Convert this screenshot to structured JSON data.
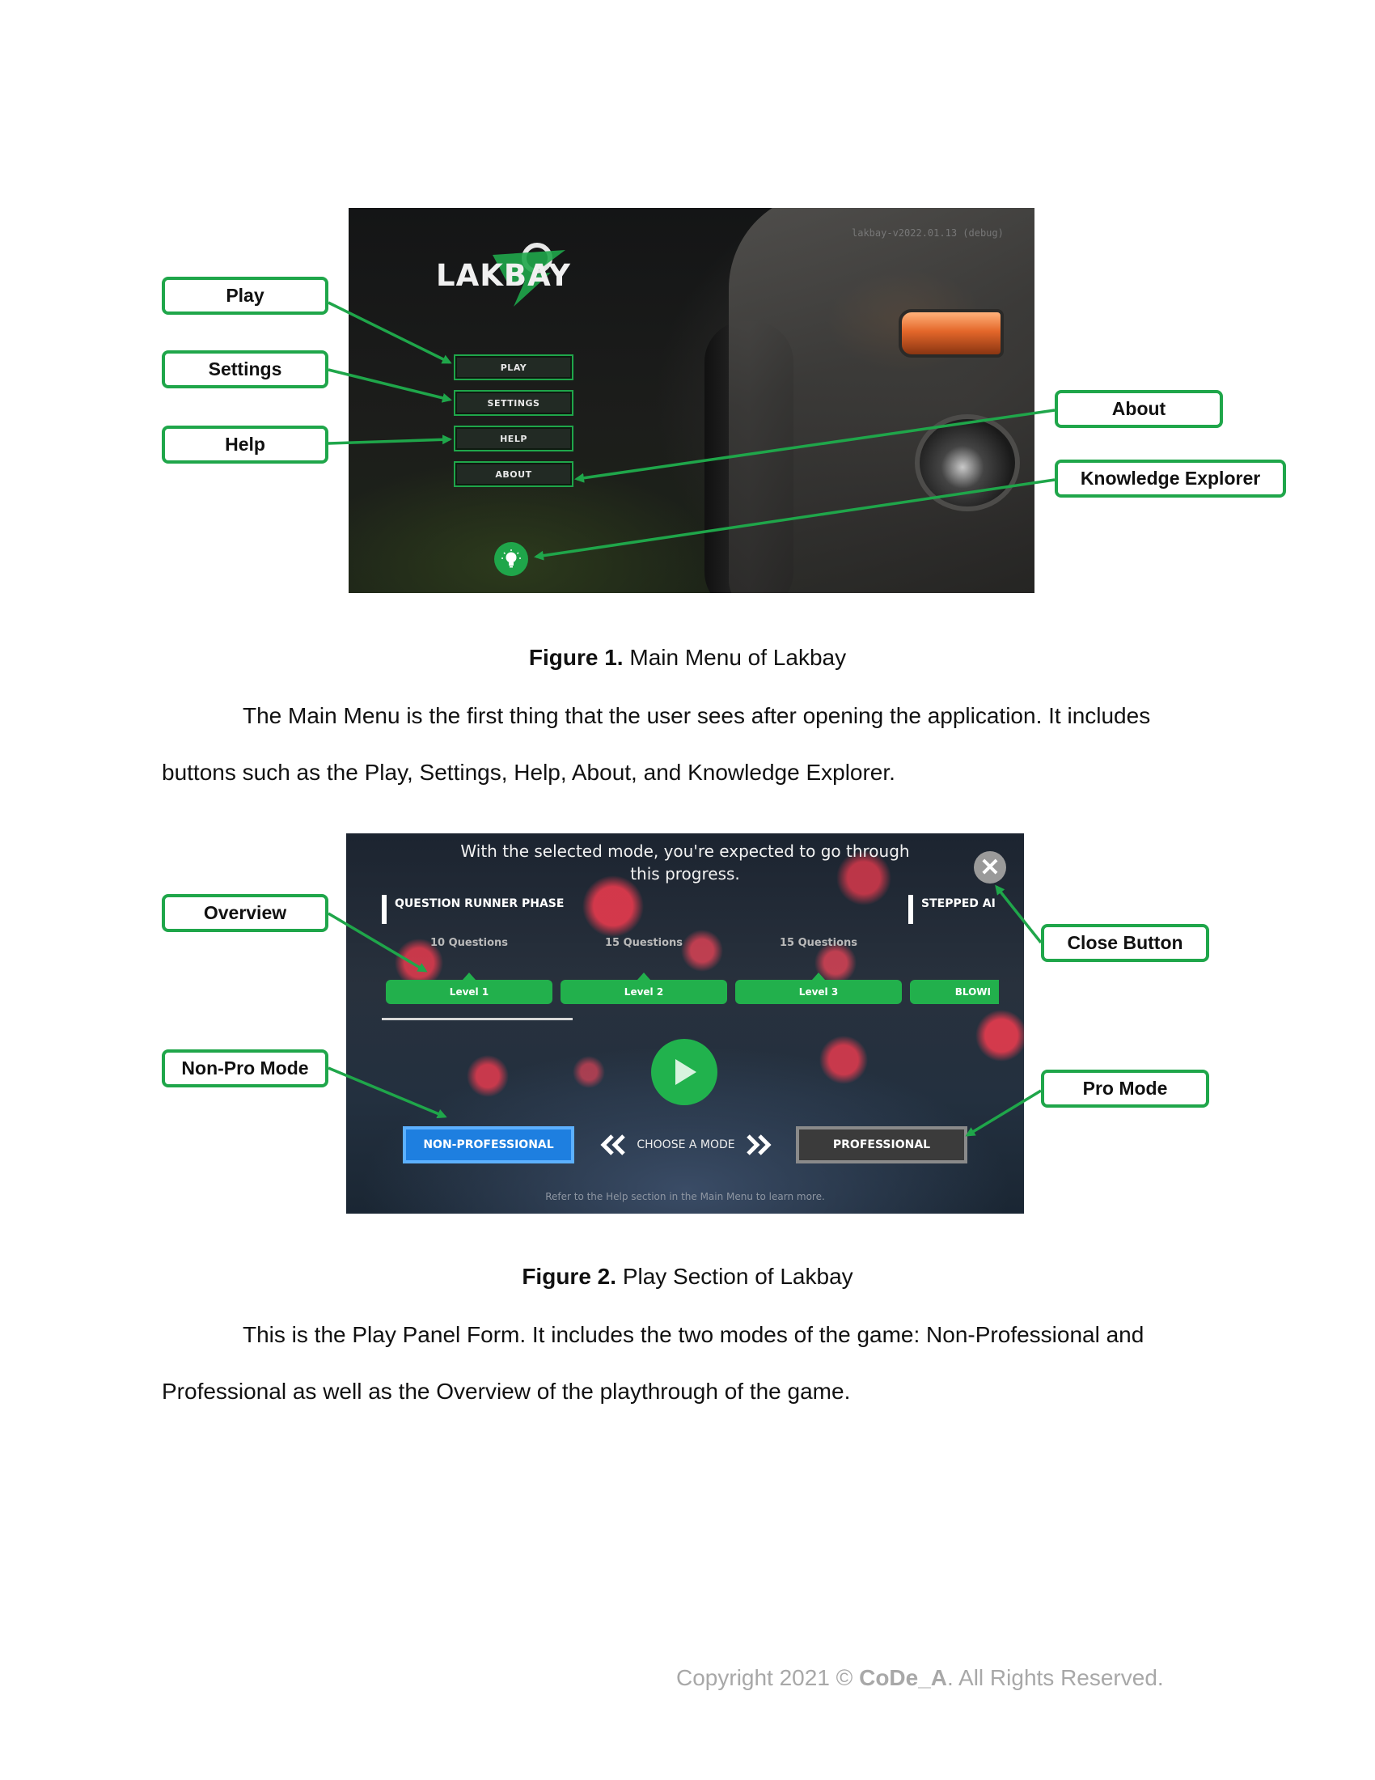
{
  "figure1": {
    "version": "lakbay-v2022.01.13 (debug)",
    "logo": "LAKBAY",
    "menu": [
      "PLAY",
      "SETTINGS",
      "HELP",
      "ABOUT"
    ],
    "knowledge_icon": "lightbulb-icon",
    "callouts": {
      "play": "Play",
      "settings": "Settings",
      "help": "Help",
      "about": "About",
      "knowledge": "Knowledge Explorer"
    },
    "caption_bold": "Figure 1.",
    "caption_text": "Main Menu of Lakbay"
  },
  "paragraph1": {
    "line1": "The Main Menu is the first thing that the user sees after opening the application. It includes",
    "line2": "buttons such as the Play, Settings, Help, About, and Knowledge Explorer."
  },
  "figure2": {
    "title_line1": "With the selected mode, you're expected to go through",
    "title_line2": "this progress.",
    "close_icon": "close-icon",
    "phase_left": "QUESTION RUNNER PHASE",
    "phase_right": "STEPPED AI",
    "questions": [
      "10 Questions",
      "15 Questions",
      "15 Questions"
    ],
    "levels": [
      "Level 1",
      "Level 2",
      "Level 3",
      "BLOWI"
    ],
    "mode_nonpro": "NON-PROFESSIONAL",
    "choose_mode": "CHOOSE A MODE",
    "mode_pro": "PROFESSIONAL",
    "hint": "Refer to the Help section in the Main Menu to learn more.",
    "callouts": {
      "overview": "Overview",
      "nonpro": "Non-Pro Mode",
      "close": "Close Button",
      "pro": "Pro Mode"
    },
    "caption_bold": "Figure 2.",
    "caption_text": "Play Section of Lakbay"
  },
  "paragraph2": {
    "line1": "This is the Play Panel Form. It includes the two modes of the game: Non-Professional and",
    "line2": "Professional as well as the Overview of the playthrough of the game."
  },
  "footer": {
    "prefix": "Copyright 2021 © ",
    "brand": "CoDe_A",
    "suffix": ". All Rights Reserved."
  },
  "colors": {
    "callout_border": "#1fa64a",
    "level_green": "#22b04c",
    "nonpro_blue": "#1e7fe0"
  }
}
